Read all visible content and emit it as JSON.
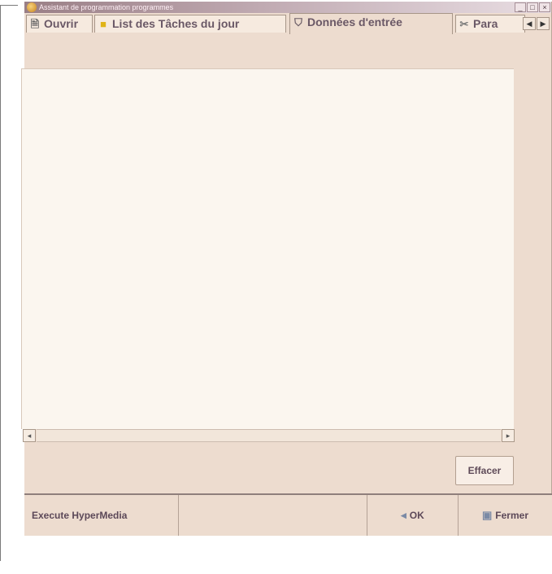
{
  "window": {
    "title": "Assistant de programmation programmes"
  },
  "tabs": [
    {
      "label": "Ouvrir",
      "icon": "document-open-icon"
    },
    {
      "label": "List des Tâches du jour",
      "icon": "folder-icon"
    },
    {
      "label": "Données d'entrée",
      "icon": "shield-icon"
    },
    {
      "label": "Para",
      "icon": "tools-icon"
    }
  ],
  "actions": {
    "effacer_label": "Effacer"
  },
  "statusbar": {
    "left_label": "Execute HyperMedia",
    "ok_label": "OK",
    "fermer_label": "Fermer"
  },
  "colors": {
    "window_bg": "#eddccf",
    "panel_bg": "#fbf6ef",
    "text": "#5c4858"
  }
}
